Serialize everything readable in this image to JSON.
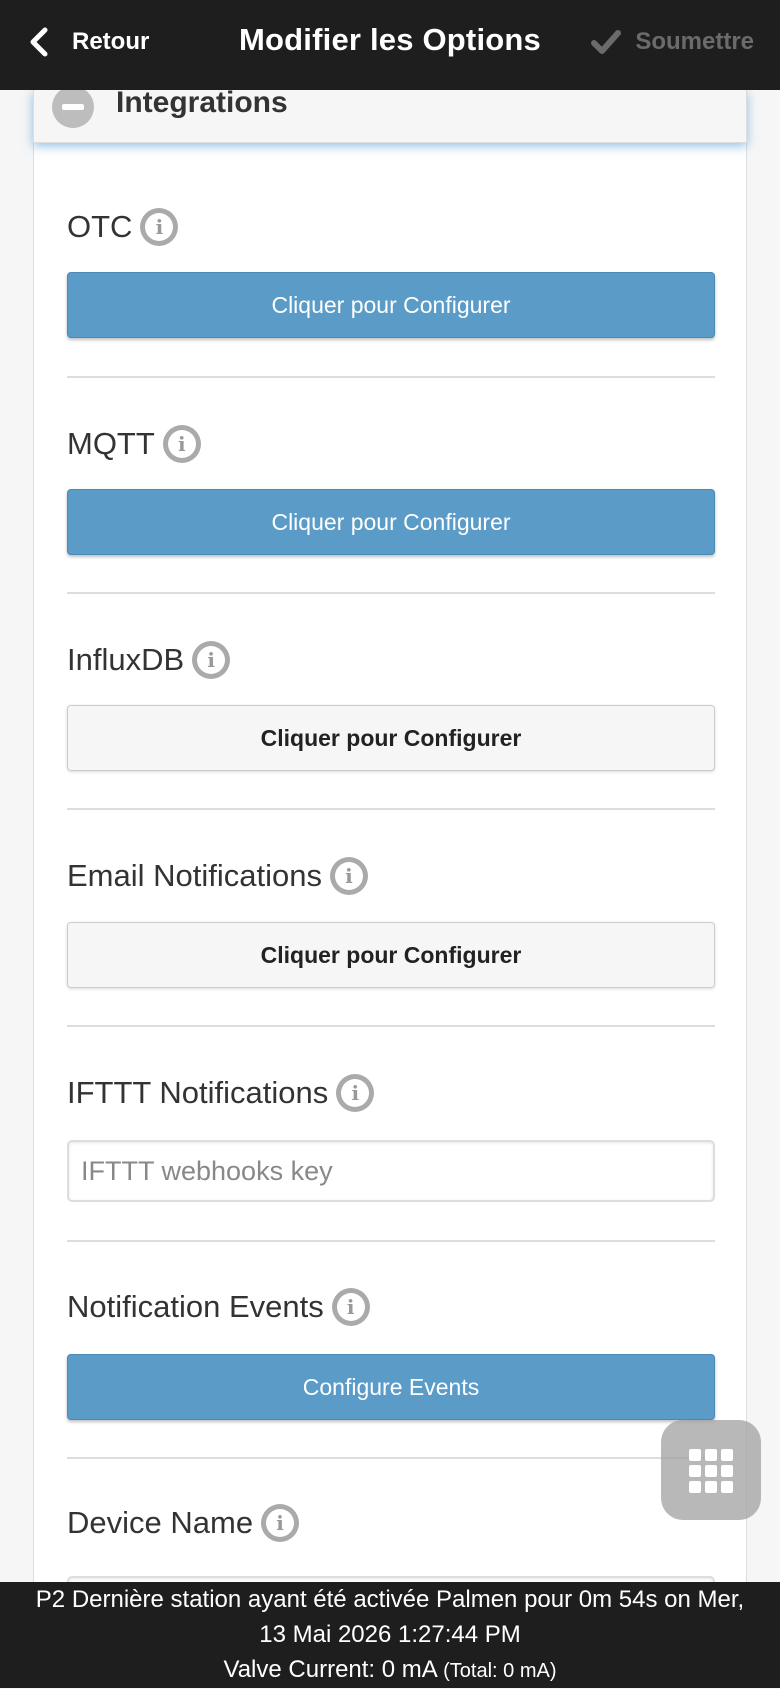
{
  "header": {
    "back_label": "Retour",
    "title": "Modifier les Options",
    "submit_label": "Soumettre"
  },
  "section": {
    "title": "Integrations"
  },
  "fields": {
    "otc": {
      "label": "OTC",
      "button": "Cliquer pour Configurer"
    },
    "mqtt": {
      "label": "MQTT",
      "button": "Cliquer pour Configurer"
    },
    "influxdb": {
      "label": "InfluxDB",
      "button": "Cliquer pour Configurer"
    },
    "email": {
      "label": "Email Notifications",
      "button": "Cliquer pour Configurer"
    },
    "ifttt": {
      "label": "IFTTT Notifications",
      "placeholder": "IFTTT webhooks key",
      "value": ""
    },
    "events": {
      "label": "Notification Events",
      "button": "Configure Events"
    },
    "device_name": {
      "label": "Device Name"
    }
  },
  "info_glyph": "i",
  "footer": {
    "line1": "P2 Dernière station ayant été activée Palmen pour 0m 54s on Mer,",
    "line2": "13 Mai 2026 1:27:44 PM",
    "valve_current": "Valve Current: 0 mA",
    "total": "(Total: 0 mA)"
  },
  "colors": {
    "header_bg": "#1e1e1e",
    "primary_button": "#5a9bc7",
    "secondary_button": "#f6f6f6"
  }
}
